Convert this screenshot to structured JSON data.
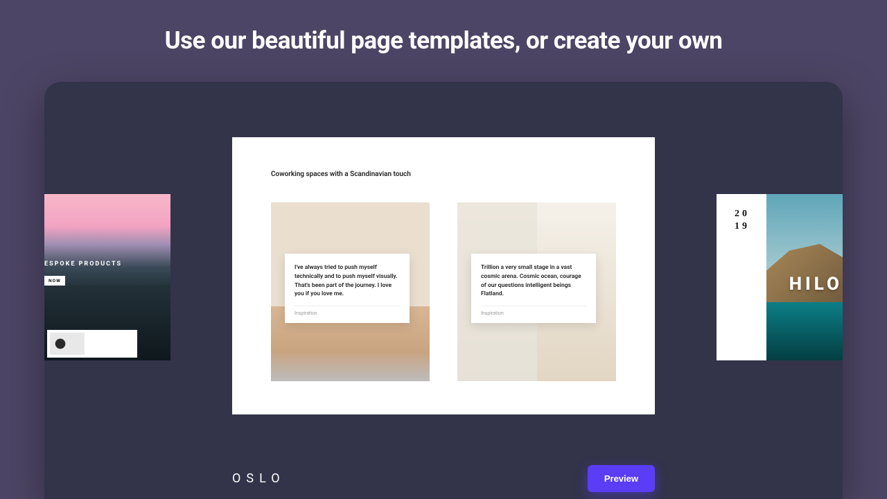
{
  "hero": {
    "title": "Use our beautiful page templates, or create your own"
  },
  "templates": {
    "center": {
      "name": "OSLO",
      "heading": "Coworking spaces with a Scandinavian touch",
      "card1": {
        "quote": "I've always tried to push myself technically and to push myself visually. That's been part of the journey. I love you if you love me.",
        "tag": "Inspiration"
      },
      "card2": {
        "quote": "Trillion a very small stage in a vast cosmic arena. Cosmic ocean, courage of our questions intelligent beings Flatland.",
        "tag": "Inspiration"
      }
    },
    "left": {
      "headline": "ESPOKE PRODUCTS",
      "button": "NOW"
    },
    "right": {
      "year1": "20",
      "year2": "19",
      "word": "HILO"
    }
  },
  "actions": {
    "preview": "Preview"
  }
}
